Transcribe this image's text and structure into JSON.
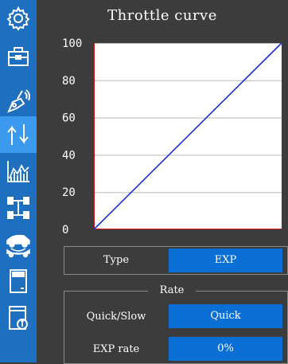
{
  "sidebar": {
    "items": [
      {
        "icon": "gear-icon",
        "active": false
      },
      {
        "icon": "toolbox-icon",
        "active": false
      },
      {
        "icon": "transmitter-icon",
        "active": false
      },
      {
        "icon": "up-down-arrows-icon",
        "active": true
      },
      {
        "icon": "graph-icon",
        "active": false
      },
      {
        "icon": "chassis-icon",
        "active": false
      },
      {
        "icon": "car-icon",
        "active": false
      },
      {
        "icon": "sd-card-icon",
        "active": false
      },
      {
        "icon": "info-card-icon",
        "active": false
      }
    ]
  },
  "screen": {
    "title": "Throttle curve"
  },
  "chart_data": {
    "type": "line",
    "title": "Throttle curve",
    "x": [
      0,
      100
    ],
    "series": [
      {
        "values": [
          0,
          100
        ]
      }
    ],
    "ylim": [
      0,
      100
    ],
    "yticks": [
      "100",
      "80",
      "60",
      "40",
      "20",
      "0"
    ],
    "grid": true,
    "line_color": "#1a2fd8",
    "axis_color": "#d01818"
  },
  "settings": {
    "type_label": "Type",
    "type_value": "EXP",
    "rate_title": "Rate",
    "quick_slow_label": "Quick/Slow",
    "quick_slow_value": "Quick",
    "exp_rate_label": "EXP rate",
    "exp_rate_value": "0%"
  }
}
